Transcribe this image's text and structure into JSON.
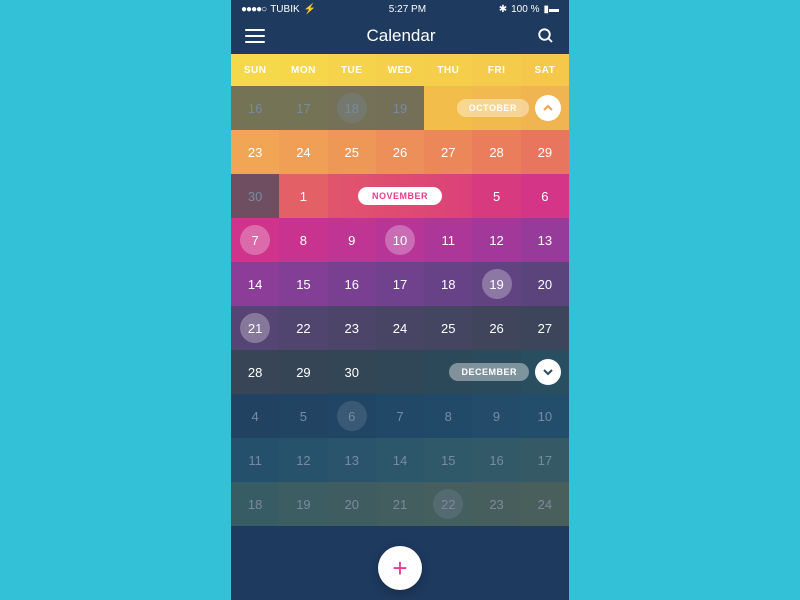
{
  "status": {
    "carrier": "TUBIK",
    "time": "5:27 PM",
    "battery": "100 %"
  },
  "title": "Calendar",
  "days": [
    "SUN",
    "MON",
    "TUE",
    "WED",
    "THU",
    "FRI",
    "SAT"
  ],
  "rows": [
    {
      "colors": [
        "#f5c94b",
        "#f5c94b",
        "#f5c550",
        "#f5c24d",
        "#f3bd4c",
        "#f2b94e",
        "#f0b550"
      ],
      "cells": [
        {
          "t": "16",
          "dim": true
        },
        {
          "t": "17",
          "dim": true
        },
        {
          "t": "18",
          "dim": true,
          "circ": true
        },
        {
          "t": "19",
          "dim": true
        },
        {
          "t": ""
        },
        {
          "t": ""
        },
        {
          "t": ""
        }
      ],
      "pill": {
        "label": "OCTOBER",
        "chev": "up"
      }
    },
    {
      "colors": [
        "#f0a655",
        "#ef9f56",
        "#ee9857",
        "#ed8f58",
        "#eb8759",
        "#ea7e5c",
        "#e8765f"
      ],
      "cells": [
        {
          "t": "23"
        },
        {
          "t": "24"
        },
        {
          "t": "25"
        },
        {
          "t": "26"
        },
        {
          "t": "27"
        },
        {
          "t": "28"
        },
        {
          "t": "29"
        }
      ]
    },
    {
      "colors": [
        "#e56d63",
        "#e36067",
        "#e1556c",
        "#de4a72",
        "#db4179",
        "#d83a80",
        "#d43587"
      ],
      "cells": [
        {
          "t": "30",
          "dim": true
        },
        {
          "t": "1"
        },
        {
          "t": "",
          "month": "NOVEMBER",
          "span": 3
        },
        null,
        null,
        {
          "t": "5"
        },
        {
          "t": "6"
        }
      ]
    },
    {
      "colors": [
        "#cf338c",
        "#c83390",
        "#c03494",
        "#b73597",
        "#ad3799",
        "#a2399a",
        "#973b9a"
      ],
      "cells": [
        {
          "t": "7",
          "circ": true
        },
        {
          "t": "8"
        },
        {
          "t": "9"
        },
        {
          "t": "10",
          "circ": true
        },
        {
          "t": "11"
        },
        {
          "t": "12"
        },
        {
          "t": "13"
        }
      ]
    },
    {
      "colors": [
        "#8c3d98",
        "#823f95",
        "#794091",
        "#70418c",
        "#684287",
        "#614381",
        "#5b447b"
      ],
      "cells": [
        {
          "t": "14"
        },
        {
          "t": "15"
        },
        {
          "t": "16"
        },
        {
          "t": "17"
        },
        {
          "t": "18"
        },
        {
          "t": "19",
          "circ": true
        },
        {
          "t": "20"
        }
      ]
    },
    {
      "colors": [
        "#554575",
        "#50456f",
        "#4c4569",
        "#484564",
        "#444560",
        "#40455c",
        "#3c4559"
      ],
      "cells": [
        {
          "t": "21",
          "circ": true
        },
        {
          "t": "22"
        },
        {
          "t": "23"
        },
        {
          "t": "24"
        },
        {
          "t": "25"
        },
        {
          "t": "26"
        },
        {
          "t": "27"
        }
      ]
    },
    {
      "colors": [
        "#384557",
        "#354556",
        "#324656",
        "#2f4757",
        "#2c4959",
        "#2a4b5c",
        "#284e60"
      ],
      "cells": [
        {
          "t": "28"
        },
        {
          "t": "29"
        },
        {
          "t": "30"
        },
        {
          "t": ""
        },
        {
          "t": ""
        },
        {
          "t": ""
        },
        {
          "t": ""
        }
      ],
      "pill": {
        "label": "DECEMBER",
        "chev": "down"
      }
    },
    {
      "colors": [
        "#275165",
        "#26556a",
        "#265a6f",
        "#265f74",
        "#276478",
        "#29697b",
        "#2b6e7d"
      ],
      "cells": [
        {
          "t": "4",
          "dim": true
        },
        {
          "t": "5",
          "dim": true
        },
        {
          "t": "6",
          "dim": true,
          "circ": true
        },
        {
          "t": "7",
          "dim": true
        },
        {
          "t": "8",
          "dim": true
        },
        {
          "t": "9",
          "dim": true
        },
        {
          "t": "10",
          "dim": true
        }
      ]
    },
    {
      "colors": [
        "#2f737e",
        "#34787e",
        "#3a7d7d",
        "#41817b",
        "#498578",
        "#518974",
        "#598c70"
      ],
      "cells": [
        {
          "t": "11",
          "dim": true
        },
        {
          "t": "12",
          "dim": true
        },
        {
          "t": "13",
          "dim": true
        },
        {
          "t": "14",
          "dim": true
        },
        {
          "t": "15",
          "dim": true
        },
        {
          "t": "16",
          "dim": true
        },
        {
          "t": "17",
          "dim": true
        }
      ]
    },
    {
      "colors": [
        "#618f6c",
        "#699168",
        "#719364",
        "#789460",
        "#7f955d",
        "#85965a",
        "#8b9758"
      ],
      "cells": [
        {
          "t": "18",
          "dim": true
        },
        {
          "t": "19",
          "dim": true
        },
        {
          "t": "20",
          "dim": true
        },
        {
          "t": "21",
          "dim": true
        },
        {
          "t": "22",
          "dim": true,
          "circ": true
        },
        {
          "t": "23",
          "dim": true
        },
        {
          "t": "24",
          "dim": true
        }
      ]
    }
  ],
  "hdrColors": [
    "#f6d94a",
    "#f6d74a",
    "#f5d44b",
    "#f5d14b",
    "#f5ce4b",
    "#f5cb4b",
    "#f5c84b"
  ]
}
